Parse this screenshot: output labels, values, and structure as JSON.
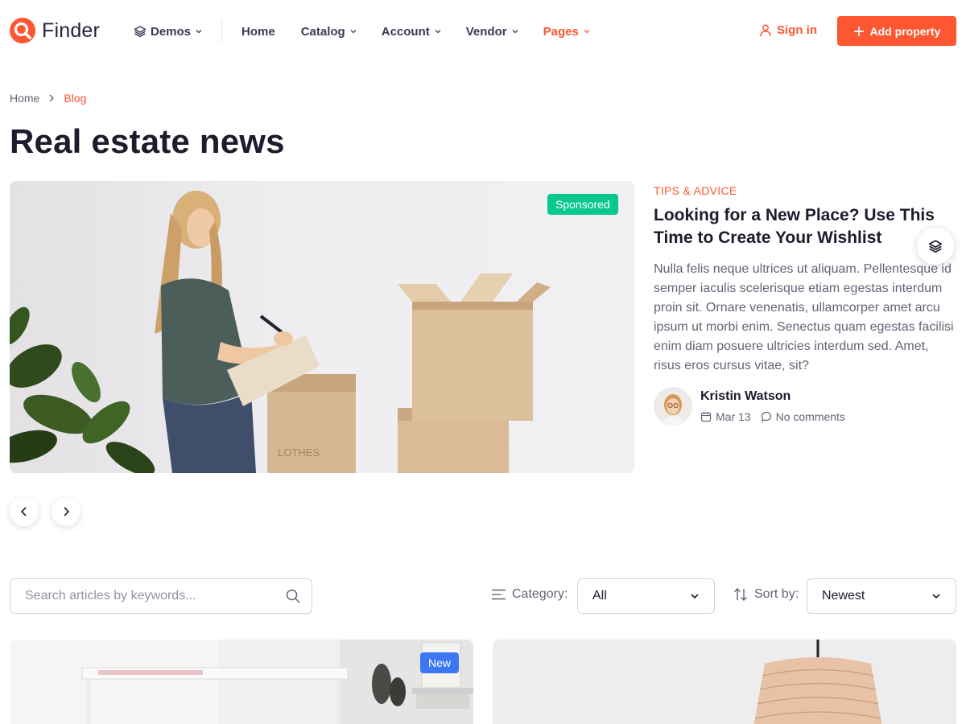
{
  "brand": {
    "name": "Finder",
    "accent": "#fd5631"
  },
  "nav": {
    "demos": "Demos",
    "home": "Home",
    "catalog": "Catalog",
    "account": "Account",
    "vendor": "Vendor",
    "pages": "Pages"
  },
  "header_actions": {
    "signin": "Sign in",
    "add_property": "Add property"
  },
  "breadcrumb": {
    "home": "Home",
    "current": "Blog"
  },
  "page_title": "Real estate news",
  "featured": {
    "badge": "Sponsored",
    "category": "Tips & Advice",
    "title": "Looking for a New Place? Use This Time to Create Your Wishlist",
    "excerpt": "Nulla felis neque ultrices ut aliquam. Pellentesque id semper iaculis scelerisque etiam egestas interdum proin sit. Ornare venenatis, ullamcorper amet arcu ipsum ut morbi enim. Senectus quam egestas facilisi enim diam posuere ultricies interdum sed. Amet, risus eros cursus vitae, sit?",
    "author": "Kristin Watson",
    "date": "Mar 13",
    "comments": "No comments"
  },
  "filters": {
    "search_placeholder": "Search articles by keywords...",
    "category_label": "Category:",
    "category_value": "All",
    "sort_label": "Sort by:",
    "sort_value": "Newest"
  },
  "cards": [
    {
      "badge": "New"
    },
    {
      "badge": ""
    }
  ],
  "colors": {
    "accent": "#fd5631",
    "sponsored": "#07c98b",
    "new_badge": "#3c76f2"
  }
}
